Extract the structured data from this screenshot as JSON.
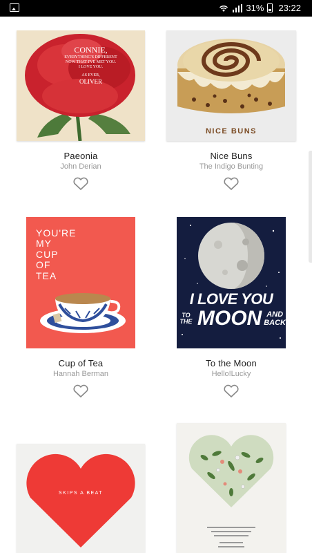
{
  "status_bar": {
    "battery_percent": "31%",
    "time": "23:22"
  },
  "cards": [
    {
      "title": "Paeonia",
      "artist": "John Derian",
      "card_text": [
        "CONNIE,",
        "EVERYTHING'S DIFFERENT",
        "NOW THAT I'VE MET YOU.",
        "I LOVE YOU.",
        "AS EVER,",
        "OLIVER"
      ]
    },
    {
      "title": "Nice Buns",
      "artist": "The Indigo Bunting",
      "card_text": [
        "NICE BUNS"
      ]
    },
    {
      "title": "Cup of Tea",
      "artist": "Hannah Berman",
      "card_text": [
        "YOU'RE",
        "MY",
        "CUP",
        "OF",
        "TEA"
      ]
    },
    {
      "title": "To the Moon",
      "artist": "Hello!Lucky",
      "card_text": [
        "I LOVE YOU",
        "TO THE",
        "MOON",
        "AND",
        "BACK"
      ]
    },
    {
      "title": "",
      "artist": "",
      "card_text": [
        "SKIPS A BEAT"
      ]
    },
    {
      "title": "",
      "artist": "",
      "card_text": []
    }
  ],
  "colors": {
    "accent_red": "#f2594f",
    "heart_outline": "#888888"
  }
}
